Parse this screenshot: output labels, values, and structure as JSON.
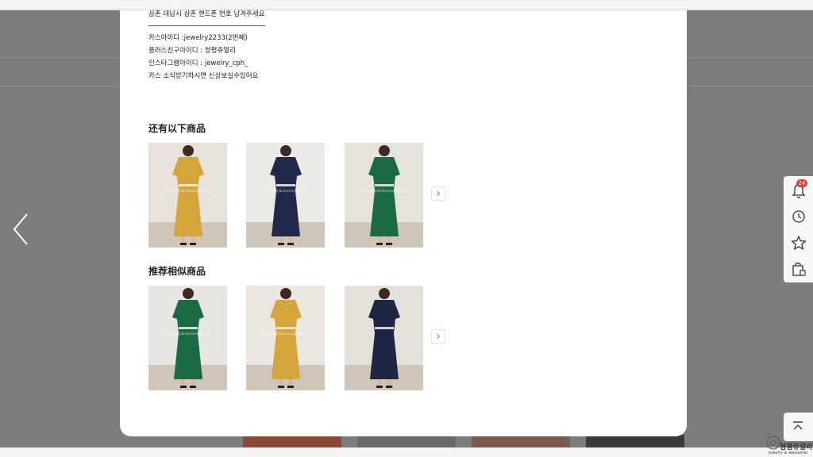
{
  "notice": {
    "heading": "삼촌 대납시 삼촌 핸드폰 번호 남겨주세요",
    "lines": [
      "카스아이디 :jewelry2233(2번째)",
      "플러스친구아이디 : 청평쥬얼리",
      "인스타그램아이디 : jewelry_cph_",
      "카스 소식받기하시면 신상보실수있어요"
    ]
  },
  "sections": [
    {
      "title": "还有以下商品",
      "products": [
        {
          "color": "mustard",
          "dress_hex": "#d4a53a",
          "wall_hex": "#e7e2da",
          "watermark": "Jewelry&Awesomeoh"
        },
        {
          "color": "navy",
          "dress_hex": "#22284a",
          "wall_hex": "#eceae6",
          "watermark": "Jewelry&Awesomeoh"
        },
        {
          "color": "green",
          "dress_hex": "#1a6b44",
          "wall_hex": "#e6e3dd",
          "watermark": "Jewelry&Awesomeoh"
        }
      ]
    },
    {
      "title": "推荐相似商品",
      "products": [
        {
          "color": "green",
          "dress_hex": "#1a6b44",
          "wall_hex": "#e8e6e2",
          "watermark": "Jewelry&Awesomeoh"
        },
        {
          "color": "mustard",
          "dress_hex": "#d4a53a",
          "wall_hex": "#ebe7e0",
          "watermark": "Jewelry&Awesomeoh"
        },
        {
          "color": "navy",
          "dress_hex": "#1d2545",
          "wall_hex": "#e4e1da",
          "watermark": ""
        }
      ]
    }
  ],
  "quickbar": {
    "cart_count": "24",
    "icons": [
      "bell-icon",
      "clock-icon",
      "star-icon",
      "shopping-bag-icon"
    ]
  },
  "logo": {
    "text": "청평쥬얼리",
    "subtext": "jewelry & awesome"
  },
  "colors": {
    "overlay": "#7d7d7d",
    "modal": "#ffffff",
    "badge": "#e03c3c"
  }
}
